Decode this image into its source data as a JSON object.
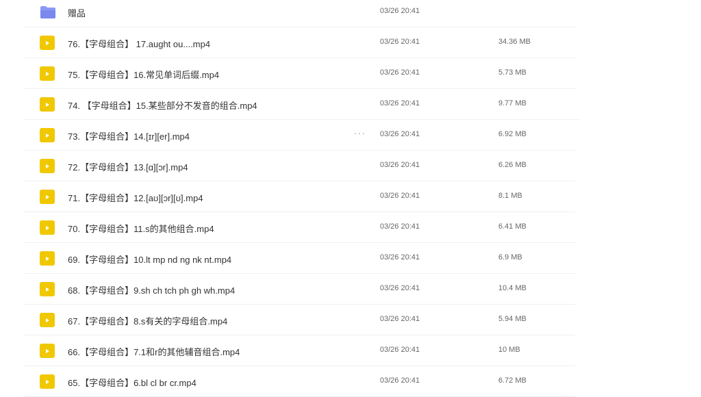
{
  "files": [
    {
      "name": "赠品",
      "date": "03/26 20:41",
      "size": "",
      "type": "folder"
    },
    {
      "name": "76.【字母组合】 17.aught ou....mp4",
      "date": "03/26 20:41",
      "size": "34.36 MB",
      "type": "video"
    },
    {
      "name": "75.【字母组合】16.常见单词后缀.mp4",
      "date": "03/26 20:41",
      "size": "5.73 MB",
      "type": "video"
    },
    {
      "name": "74. 【字母组合】15.某些部分不发音的组合.mp4",
      "date": "03/26 20:41",
      "size": "9.77 MB",
      "type": "video"
    },
    {
      "name": "73.【字母组合】14.[ɪr][er].mp4",
      "date": "03/26 20:41",
      "size": "6.92 MB",
      "type": "video",
      "hovered": true,
      "more_label": "···"
    },
    {
      "name": "72.【字母组合】13.[ɑ][ɔr].mp4",
      "date": "03/26 20:41",
      "size": "6.26 MB",
      "type": "video"
    },
    {
      "name": "71.【字母组合】12.[aʊ][ɔr][ʊ].mp4",
      "date": "03/26 20:41",
      "size": "8.1 MB",
      "type": "video"
    },
    {
      "name": "70.【字母组合】11.s的其他组合.mp4",
      "date": "03/26 20:41",
      "size": "6.41 MB",
      "type": "video"
    },
    {
      "name": "69.【字母组合】10.lt mp nd ng nk nt.mp4",
      "date": "03/26 20:41",
      "size": "6.9 MB",
      "type": "video"
    },
    {
      "name": "68.【字母组合】9.sh ch tch ph gh wh.mp4",
      "date": "03/26 20:41",
      "size": "10.4 MB",
      "type": "video"
    },
    {
      "name": "67.【字母组合】8.s有关的字母组合.mp4",
      "date": "03/26 20:41",
      "size": "5.94 MB",
      "type": "video"
    },
    {
      "name": "66.【字母组合】7.1和r的其他辅音组合.mp4",
      "date": "03/26 20:41",
      "size": "10 MB",
      "type": "video"
    },
    {
      "name": "65.【字母组合】6.bl cl br cr.mp4",
      "date": "03/26 20:41",
      "size": "6.72 MB",
      "type": "video"
    }
  ],
  "colors": {
    "video_icon": "#f0c800",
    "folder_icon": "#7d8cf0"
  }
}
